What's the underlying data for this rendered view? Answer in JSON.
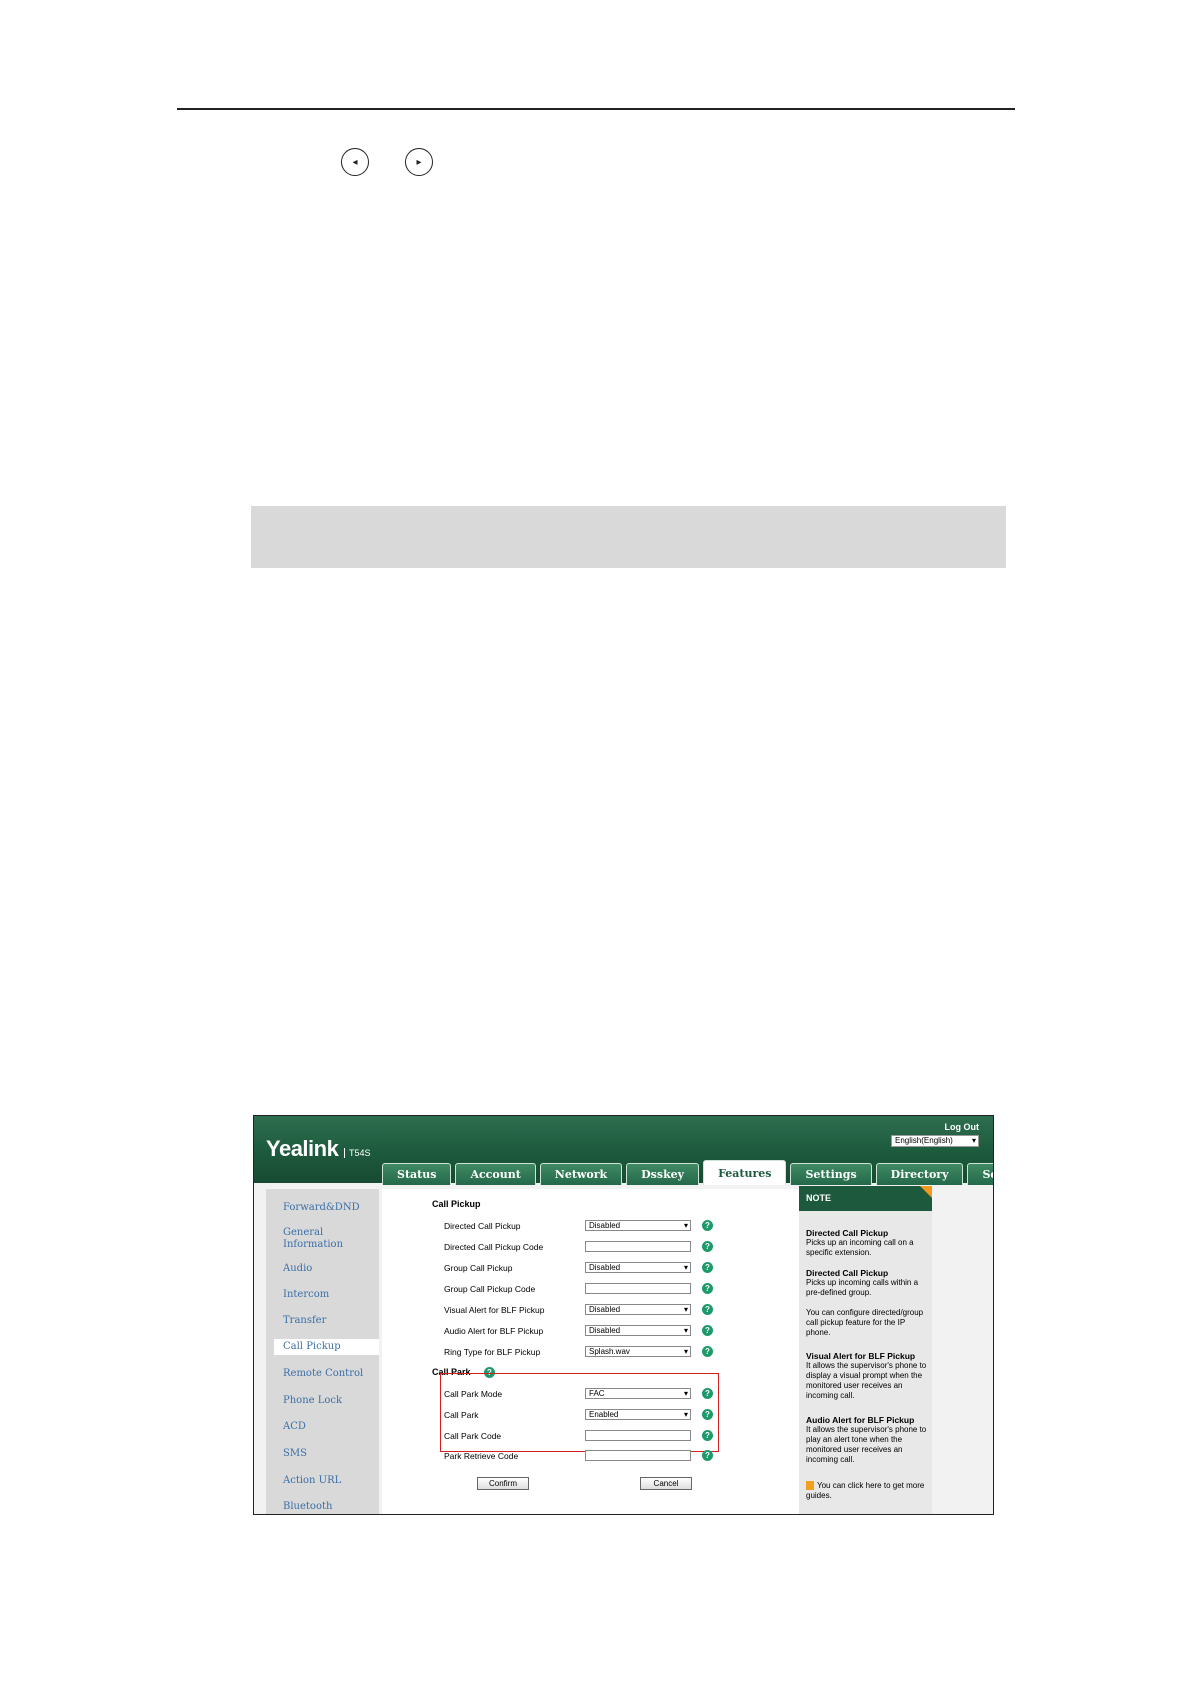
{
  "page": {
    "prev_arrow": "◂",
    "next_arrow": "▸"
  },
  "ui": {
    "logo": "Yealink",
    "model": "T54S",
    "logout": "Log Out",
    "language": "English(English)",
    "tabs": [
      "Status",
      "Account",
      "Network",
      "Dsskey",
      "Features",
      "Settings",
      "Directory",
      "Security"
    ],
    "active_tab": "Features",
    "sidebar": [
      "Forward&DND",
      "General Information",
      "Audio",
      "Intercom",
      "Transfer",
      "Call Pickup",
      "Remote Control",
      "Phone Lock",
      "ACD",
      "SMS",
      "Action URL",
      "Bluetooth"
    ],
    "sidebar_active": "Call Pickup",
    "sections": {
      "call_pickup": "Call Pickup",
      "call_park": "Call Park"
    },
    "fields": [
      {
        "label": "Directed Call Pickup",
        "type": "select",
        "value": "Disabled"
      },
      {
        "label": "Directed Call Pickup Code",
        "type": "input",
        "value": ""
      },
      {
        "label": "Group Call Pickup",
        "type": "select",
        "value": "Disabled"
      },
      {
        "label": "Group Call Pickup Code",
        "type": "input",
        "value": ""
      },
      {
        "label": "Visual Alert for BLF Pickup",
        "type": "select",
        "value": "Disabled"
      },
      {
        "label": "Audio Alert for BLF Pickup",
        "type": "select",
        "value": "Disabled"
      },
      {
        "label": "Ring Type for BLF Pickup",
        "type": "select",
        "value": "Splash.wav"
      },
      {
        "label": "Call Park Mode",
        "type": "select",
        "value": "FAC"
      },
      {
        "label": "Call Park",
        "type": "select",
        "value": "Enabled"
      },
      {
        "label": "Call Park Code",
        "type": "input",
        "value": ""
      },
      {
        "label": "Park Retrieve Code",
        "type": "input",
        "value": ""
      }
    ],
    "help_glyph": "?",
    "confirm": "Confirm",
    "cancel": "Cancel",
    "note": {
      "title": "NOTE",
      "blocks": [
        {
          "t": "Directed Call Pickup",
          "d": "Picks up an incoming call on a specific extension."
        },
        {
          "t": "Directed Call Pickup",
          "d": "Picks up incoming calls within a pre-defined group."
        },
        {
          "t": "",
          "d": "You can configure directed/group call pickup feature for the IP phone."
        },
        {
          "t": "Visual Alert for BLF Pickup",
          "d": "It allows the supervisor's phone to display a visual prompt when the monitored user receives an incoming call."
        },
        {
          "t": "Audio Alert for BLF Pickup",
          "d": "It allows the supervisor's phone to play an alert tone when the monitored user receives an incoming call."
        }
      ],
      "guide": "You can click here to get more guides."
    }
  }
}
